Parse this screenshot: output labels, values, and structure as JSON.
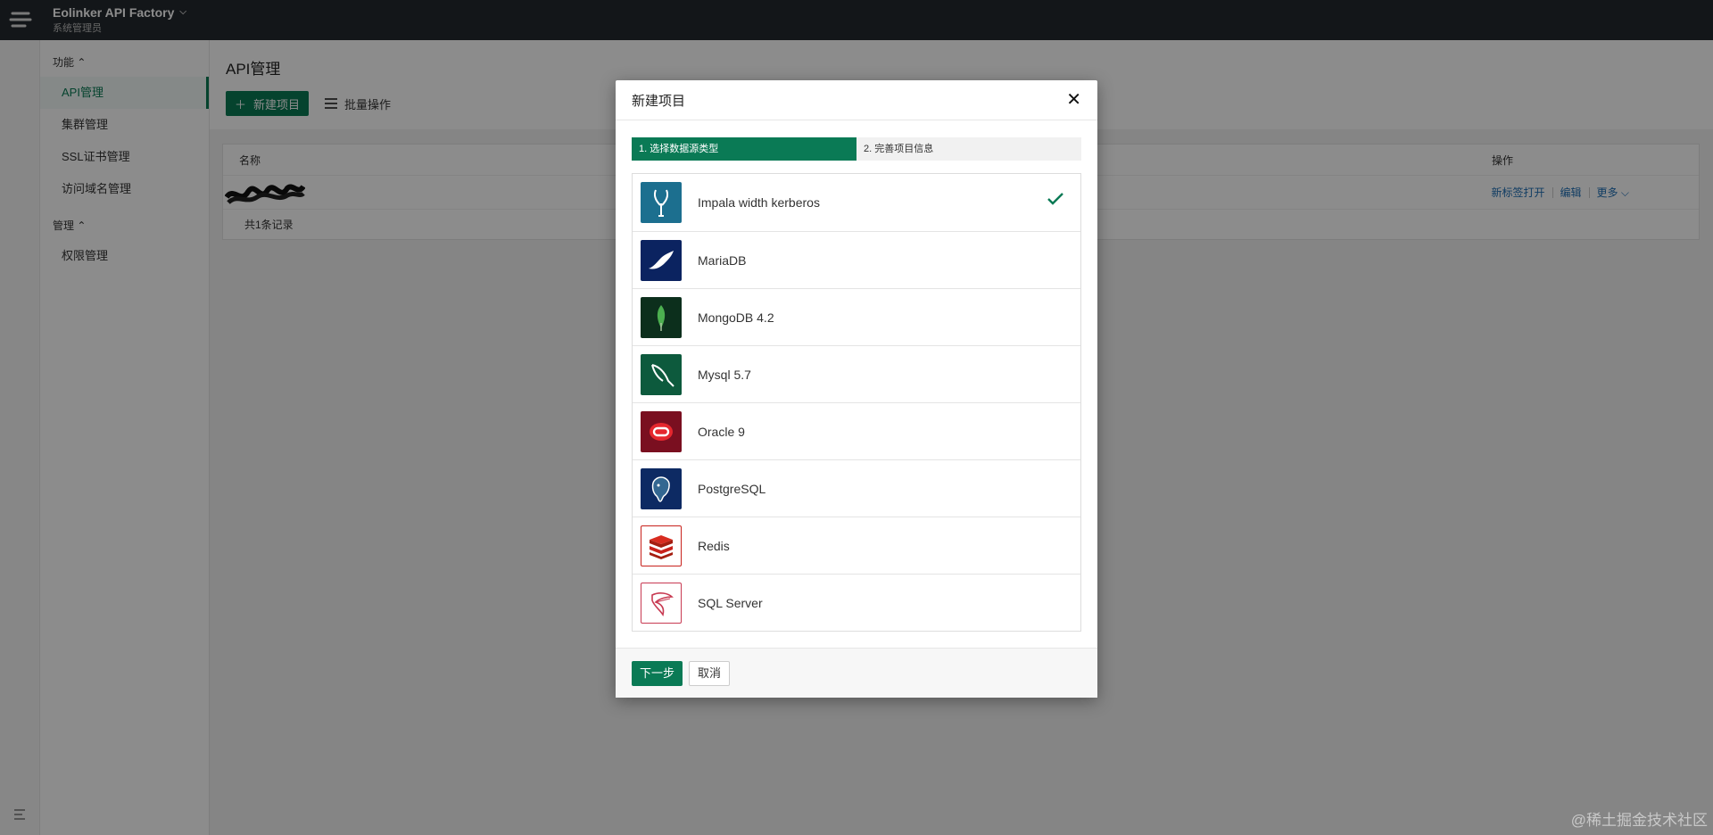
{
  "app": {
    "title": "Eolinker API Factory",
    "subtitle": "系统管理员"
  },
  "sidebar": {
    "groups": [
      {
        "label": "功能 ⌃",
        "items": [
          "API管理",
          "集群管理",
          "SSL证书管理",
          "访问域名管理"
        ]
      },
      {
        "label": "管理 ⌃",
        "items": [
          "权限管理"
        ]
      }
    ],
    "active_item": "API管理"
  },
  "main": {
    "title": "API管理",
    "new_project_label": "新建项目",
    "batch_label": "批量操作",
    "table": {
      "col_name": "名称",
      "col_actions": "操作",
      "row_actions": [
        "新标签打开",
        "编辑",
        "更多"
      ],
      "footer": "共1条记录"
    }
  },
  "modal": {
    "title": "新建项目",
    "close": "✕",
    "steps": [
      "1. 选择数据源类型",
      "2. 完善项目信息"
    ],
    "active_step": 0,
    "items": [
      {
        "label": "Impala width kerberos",
        "icon": "impala-icon",
        "color": "#1c6f8f",
        "selected": true
      },
      {
        "label": "MariaDB",
        "icon": "mariadb-seal-icon",
        "color": "#0b2360"
      },
      {
        "label": "MongoDB 4.2",
        "icon": "mongodb-leaf-icon",
        "color": "#0c2f1c"
      },
      {
        "label": "Mysql 5.7",
        "icon": "mysql-dolphin-icon",
        "color": "#0d5a3d"
      },
      {
        "label": "Oracle 9",
        "icon": "oracle-icon",
        "color": "#7a0f20"
      },
      {
        "label": "PostgreSQL",
        "icon": "postgresql-elephant-icon",
        "color": "#0d2a63"
      },
      {
        "label": "Redis",
        "icon": "redis-icon",
        "color": "#c8221c"
      },
      {
        "label": "SQL Server",
        "icon": "sqlserver-icon",
        "color": "#c83a52"
      }
    ],
    "next_label": "下一步",
    "cancel_label": "取消"
  },
  "watermark": "@稀土掘金技术社区",
  "colors": {
    "accent": "#0a7a55",
    "topbar": "#24292e",
    "link": "#1f6fb5"
  }
}
